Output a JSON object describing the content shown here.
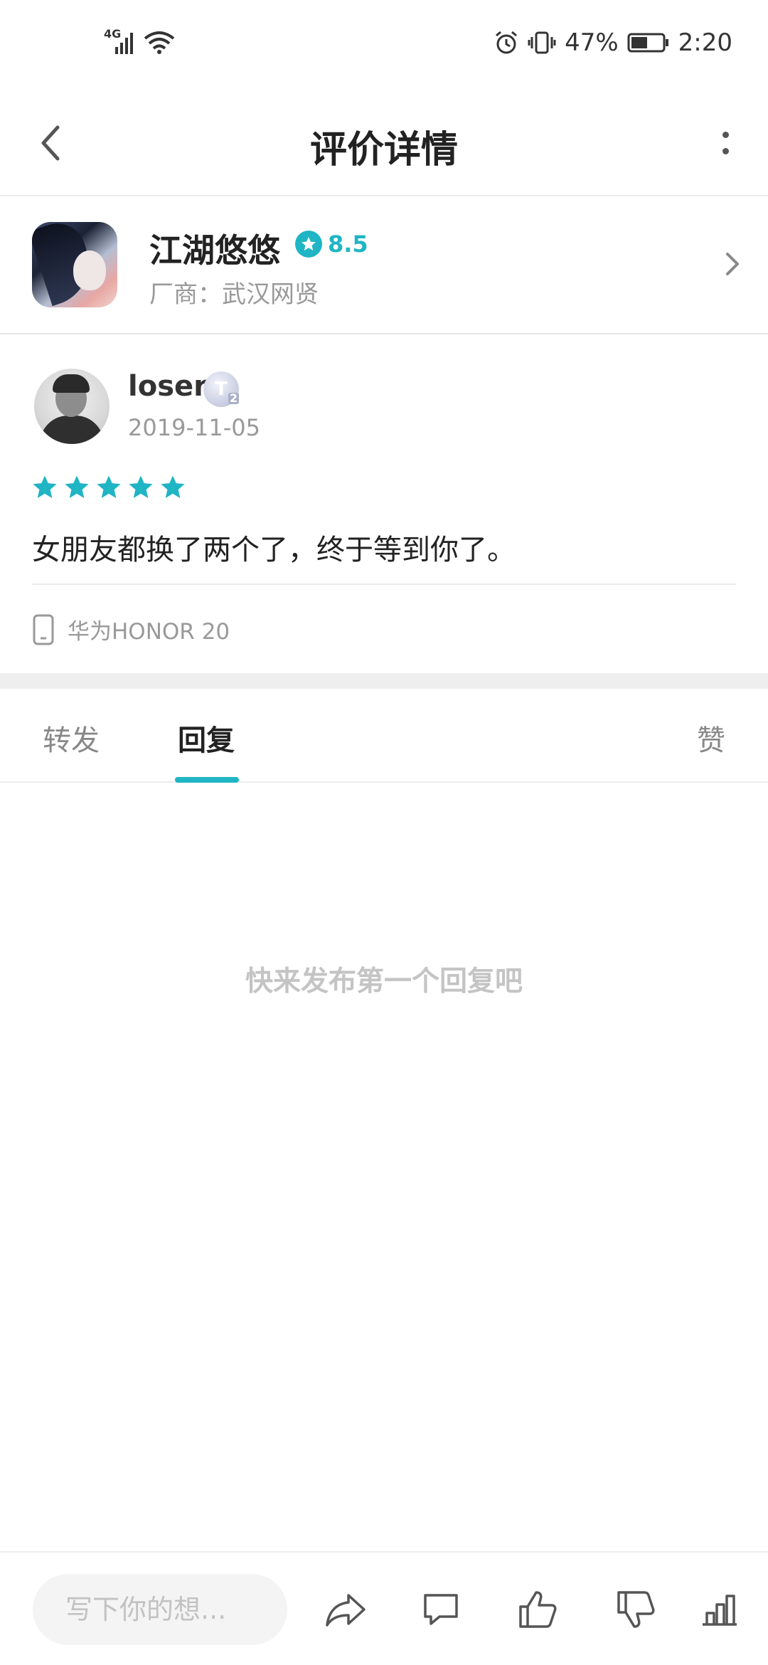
{
  "status_bar": {
    "network": "4G",
    "battery_percent": "47%",
    "time": "2:20"
  },
  "header": {
    "title": "评价详情"
  },
  "app": {
    "name": "江湖悠悠",
    "rating": "8.5",
    "vendor": "厂商：武汉网贤"
  },
  "review": {
    "username": "loser",
    "level_badge": "T",
    "level_sub": "2",
    "date": "2019-11-05",
    "stars": 5,
    "text": "女朋友都换了两个了，终于等到你了。",
    "device": "华为HONOR 20"
  },
  "tabs": {
    "forward": "转发",
    "reply": "回复",
    "like": "赞",
    "active": "reply"
  },
  "empty_hint": "快来发布第一个回复吧",
  "bottom_bar": {
    "input_placeholder": "写下你的想..."
  },
  "colors": {
    "accent": "#1fb5c4",
    "muted_text": "#999999"
  }
}
